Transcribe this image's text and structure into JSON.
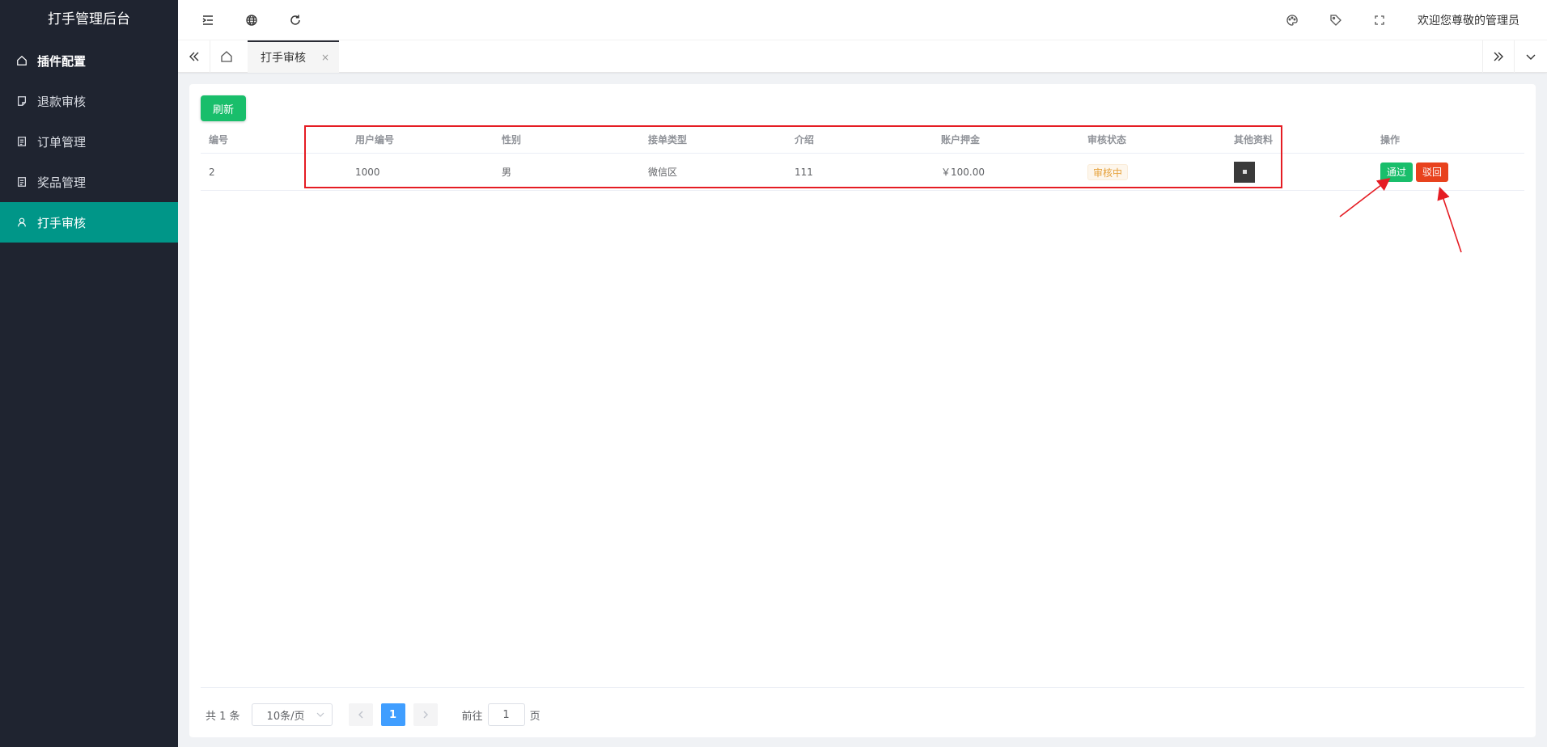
{
  "app": {
    "title": "打手管理后台"
  },
  "sidebar": {
    "items": [
      {
        "label": "插件配置",
        "icon": "home-icon"
      },
      {
        "label": "退款审核",
        "icon": "note-icon"
      },
      {
        "label": "订单管理",
        "icon": "document-icon"
      },
      {
        "label": "奖品管理",
        "icon": "document-icon"
      },
      {
        "label": "打手审核",
        "icon": "user-icon"
      }
    ]
  },
  "header": {
    "welcome": "欢迎您尊敬的管理员"
  },
  "tabs": {
    "active_label": "打手审核",
    "close_glyph": "×"
  },
  "toolbar": {
    "refresh_label": "刷新"
  },
  "table": {
    "headers": [
      "编号",
      "用户编号",
      "性别",
      "接单类型",
      "介绍",
      "账户押金",
      "审核状态",
      "其他资料",
      "操作"
    ],
    "rows": [
      {
        "id": "2",
        "user_id": "1000",
        "gender": "男",
        "order_type": "微信区",
        "intro": "111",
        "deposit": "￥100.00",
        "status": "审核中",
        "actions": {
          "pass": "通过",
          "reject": "驳回"
        }
      }
    ]
  },
  "pagination": {
    "total_text": "共 1 条",
    "page_size": "10条/页",
    "current_page": "1",
    "goto_prefix": "前往",
    "goto_value": "1",
    "goto_suffix": "页"
  },
  "colors": {
    "sidebar_bg": "#1f2430",
    "active_menu": "#009688",
    "success": "#19be6b",
    "danger": "#e8421d",
    "warning": "#e6a23c",
    "primary": "#409eff",
    "highlight": "#e51c23"
  }
}
